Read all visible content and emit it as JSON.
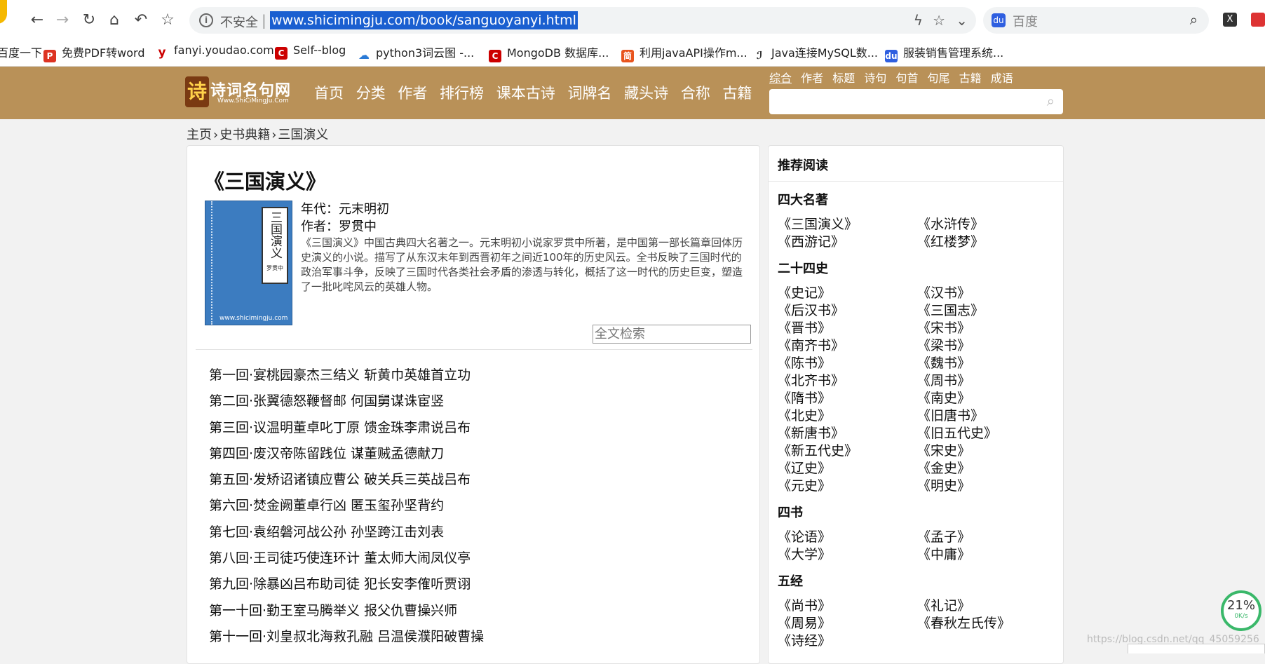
{
  "browser": {
    "insecure_label": "不安全",
    "url": "www.shicimingju.com/book/sanguoyanyi.html",
    "search_placeholder": "百度",
    "bookmarks": [
      "百度一下",
      "免费PDF转word",
      "fanyi.youdao.com",
      "Self--blog",
      "python3词云图 -...",
      "MongoDB 数据库...",
      "利用javaAPI操作m...",
      "Java连接MySQL数...",
      "服装销售管理系统..."
    ]
  },
  "site": {
    "logo_text": "诗词名句网",
    "logo_sub": "Www.ShiCiMingJu.Com",
    "nav": [
      "首页",
      "分类",
      "作者",
      "排行榜",
      "课本古诗",
      "词牌名",
      "藏头诗",
      "合称",
      "古籍"
    ],
    "search_tabs": [
      "综合",
      "作者",
      "标题",
      "诗句",
      "句首",
      "句尾",
      "古籍",
      "成语"
    ]
  },
  "breadcrumb": [
    "主页",
    "史书典籍",
    "三国演义"
  ],
  "book": {
    "title": "《三国演义》",
    "cover_title": "三国演义",
    "cover_author": "罗贯中",
    "cover_site": "www.shicimingju.com",
    "era": "年代：元末明初",
    "author": "作者：罗贯中",
    "description": "《三国演义》中国古典四大名著之一。元末明初小说家罗贯中所著，是中国第一部长篇章回体历史演义的小说。描写了从东汉末年到西晋初年之间近100年的历史风云。全书反映了三国时代的政治军事斗争，反映了三国时代各类社会矛盾的渗透与转化，概括了这一时代的历史巨变，塑造了一批叱咤风云的英雄人物。",
    "fulltext_placeholder": "全文检索"
  },
  "chapters": [
    "第一回·宴桃园豪杰三结义 斩黄巾英雄首立功",
    "第二回·张翼德怒鞭督邮 何国舅谋诛宦竖",
    "第三回·议温明董卓叱丁原 馈金珠李肃说吕布",
    "第四回·废汉帝陈留践位 谋董贼孟德献刀",
    "第五回·发矫诏诸镇应曹公 破关兵三英战吕布",
    "第六回·焚金阙董卓行凶 匿玉玺孙坚背约",
    "第七回·袁绍磐河战公孙 孙坚跨江击刘表",
    "第八回·王司徒巧使连环计 董太师大闹凤仪亭",
    "第九回·除暴凶吕布助司徒 犯长安李傕听贾诩",
    "第一十回·勤王室马腾举义 报父仇曹操兴师",
    "第十一回·刘皇叔北海救孔融 吕温侯濮阳破曹操"
  ],
  "sidebar": {
    "title": "推荐阅读",
    "sections": [
      {
        "title": "四大名著",
        "books": [
          "《三国演义》",
          "《水浒传》",
          "《西游记》",
          "《红楼梦》"
        ]
      },
      {
        "title": "二十四史",
        "books": [
          "《史记》",
          "《汉书》",
          "《后汉书》",
          "《三国志》",
          "《晋书》",
          "《宋书》",
          "《南齐书》",
          "《梁书》",
          "《陈书》",
          "《魏书》",
          "《北齐书》",
          "《周书》",
          "《隋书》",
          "《南史》",
          "《北史》",
          "《旧唐书》",
          "《新唐书》",
          "《旧五代史》",
          "《新五代史》",
          "《宋史》",
          "《辽史》",
          "《金史》",
          "《元史》",
          "《明史》"
        ]
      },
      {
        "title": "四书",
        "books": [
          "《论语》",
          "《孟子》",
          "《大学》",
          "《中庸》"
        ]
      },
      {
        "title": "五经",
        "books": [
          "《尚书》",
          "《礼记》",
          "《周易》",
          "《春秋左氏传》",
          "《诗经》"
        ]
      }
    ]
  },
  "overlay": {
    "speed_pct": "21%",
    "speed_rate": "0K/s",
    "watermark": "https://blog.csdn.net/qq_45059256"
  }
}
